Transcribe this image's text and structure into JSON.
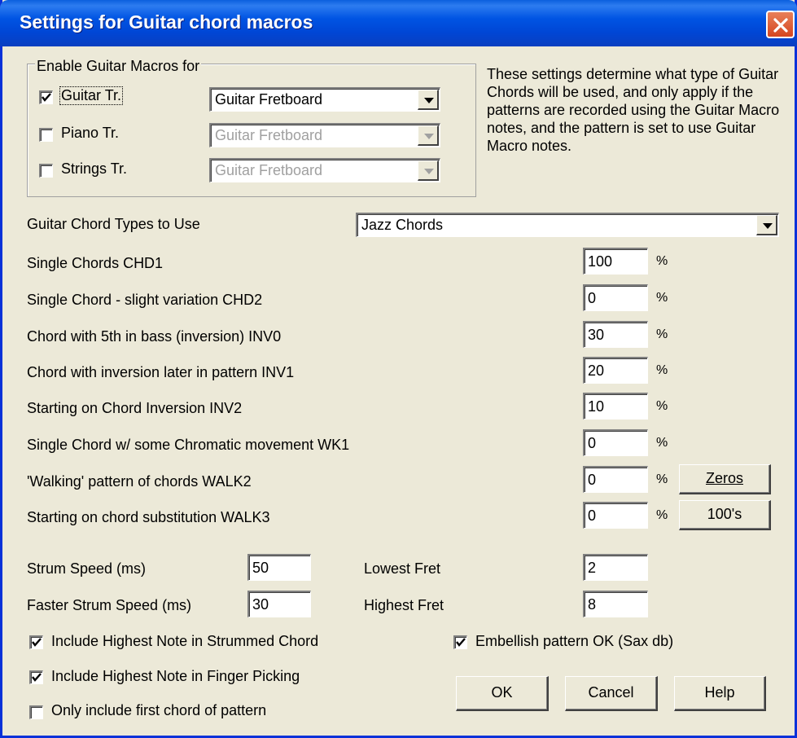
{
  "window": {
    "title": "Settings for Guitar chord macros",
    "close_icon": "close-icon"
  },
  "group": {
    "legend": "Enable Guitar Macros for",
    "rows": [
      {
        "label": "Guitar Tr.",
        "checked": true,
        "value": "Guitar Fretboard",
        "enabled": true
      },
      {
        "label": "Piano Tr.",
        "checked": false,
        "value": "Guitar Fretboard",
        "enabled": false
      },
      {
        "label": "Strings Tr.",
        "checked": false,
        "value": "Guitar Fretboard",
        "enabled": false
      }
    ]
  },
  "description": "These settings determine what type of Guitar Chords will be used, and only apply if the patterns are recorded using the Guitar Macro notes, and the pattern is set to use Guitar Macro notes.",
  "chord_types": {
    "label": "Guitar Chord Types to Use",
    "value": "Jazz Chords"
  },
  "percent_symbol": "%",
  "percent_rows": [
    {
      "label": "Single Chords CHD1",
      "value": "100"
    },
    {
      "label": "Single Chord - slight variation  CHD2",
      "value": "0"
    },
    {
      "label": "Chord with 5th in bass (inversion)  INV0",
      "value": "30"
    },
    {
      "label": "Chord with inversion later in pattern  INV1",
      "value": "20"
    },
    {
      "label": "Starting on Chord Inversion  INV2",
      "value": "10"
    },
    {
      "label": "Single Chord w/ some Chromatic movement  WK1",
      "value": "0"
    },
    {
      "label": "'Walking' pattern of chords  WALK2",
      "value": "0"
    },
    {
      "label": "Starting on chord substitution  WALK3",
      "value": "0"
    }
  ],
  "buttons": {
    "zeros": "Zeros",
    "hundreds": "100's",
    "ok": "OK",
    "cancel": "Cancel",
    "help": "Help"
  },
  "strum": {
    "speed_label": "Strum Speed (ms)",
    "speed_value": "50",
    "faster_label": "Faster Strum Speed (ms)",
    "faster_value": "30",
    "lowest_label": "Lowest Fret",
    "lowest_value": "2",
    "highest_label": "Highest Fret",
    "highest_value": "8"
  },
  "options": [
    {
      "label": "Include Highest Note in Strummed Chord",
      "checked": true
    },
    {
      "label": "Include Highest Note in Finger Picking",
      "checked": true
    },
    {
      "label": "Only include first chord of pattern",
      "checked": false
    },
    {
      "label": "Embellish pattern OK (Sax db)",
      "checked": true
    }
  ],
  "colors": {
    "title_bar": "#0054e3",
    "dialog_bg": "#ece9d8",
    "close_button": "#d5461f"
  }
}
